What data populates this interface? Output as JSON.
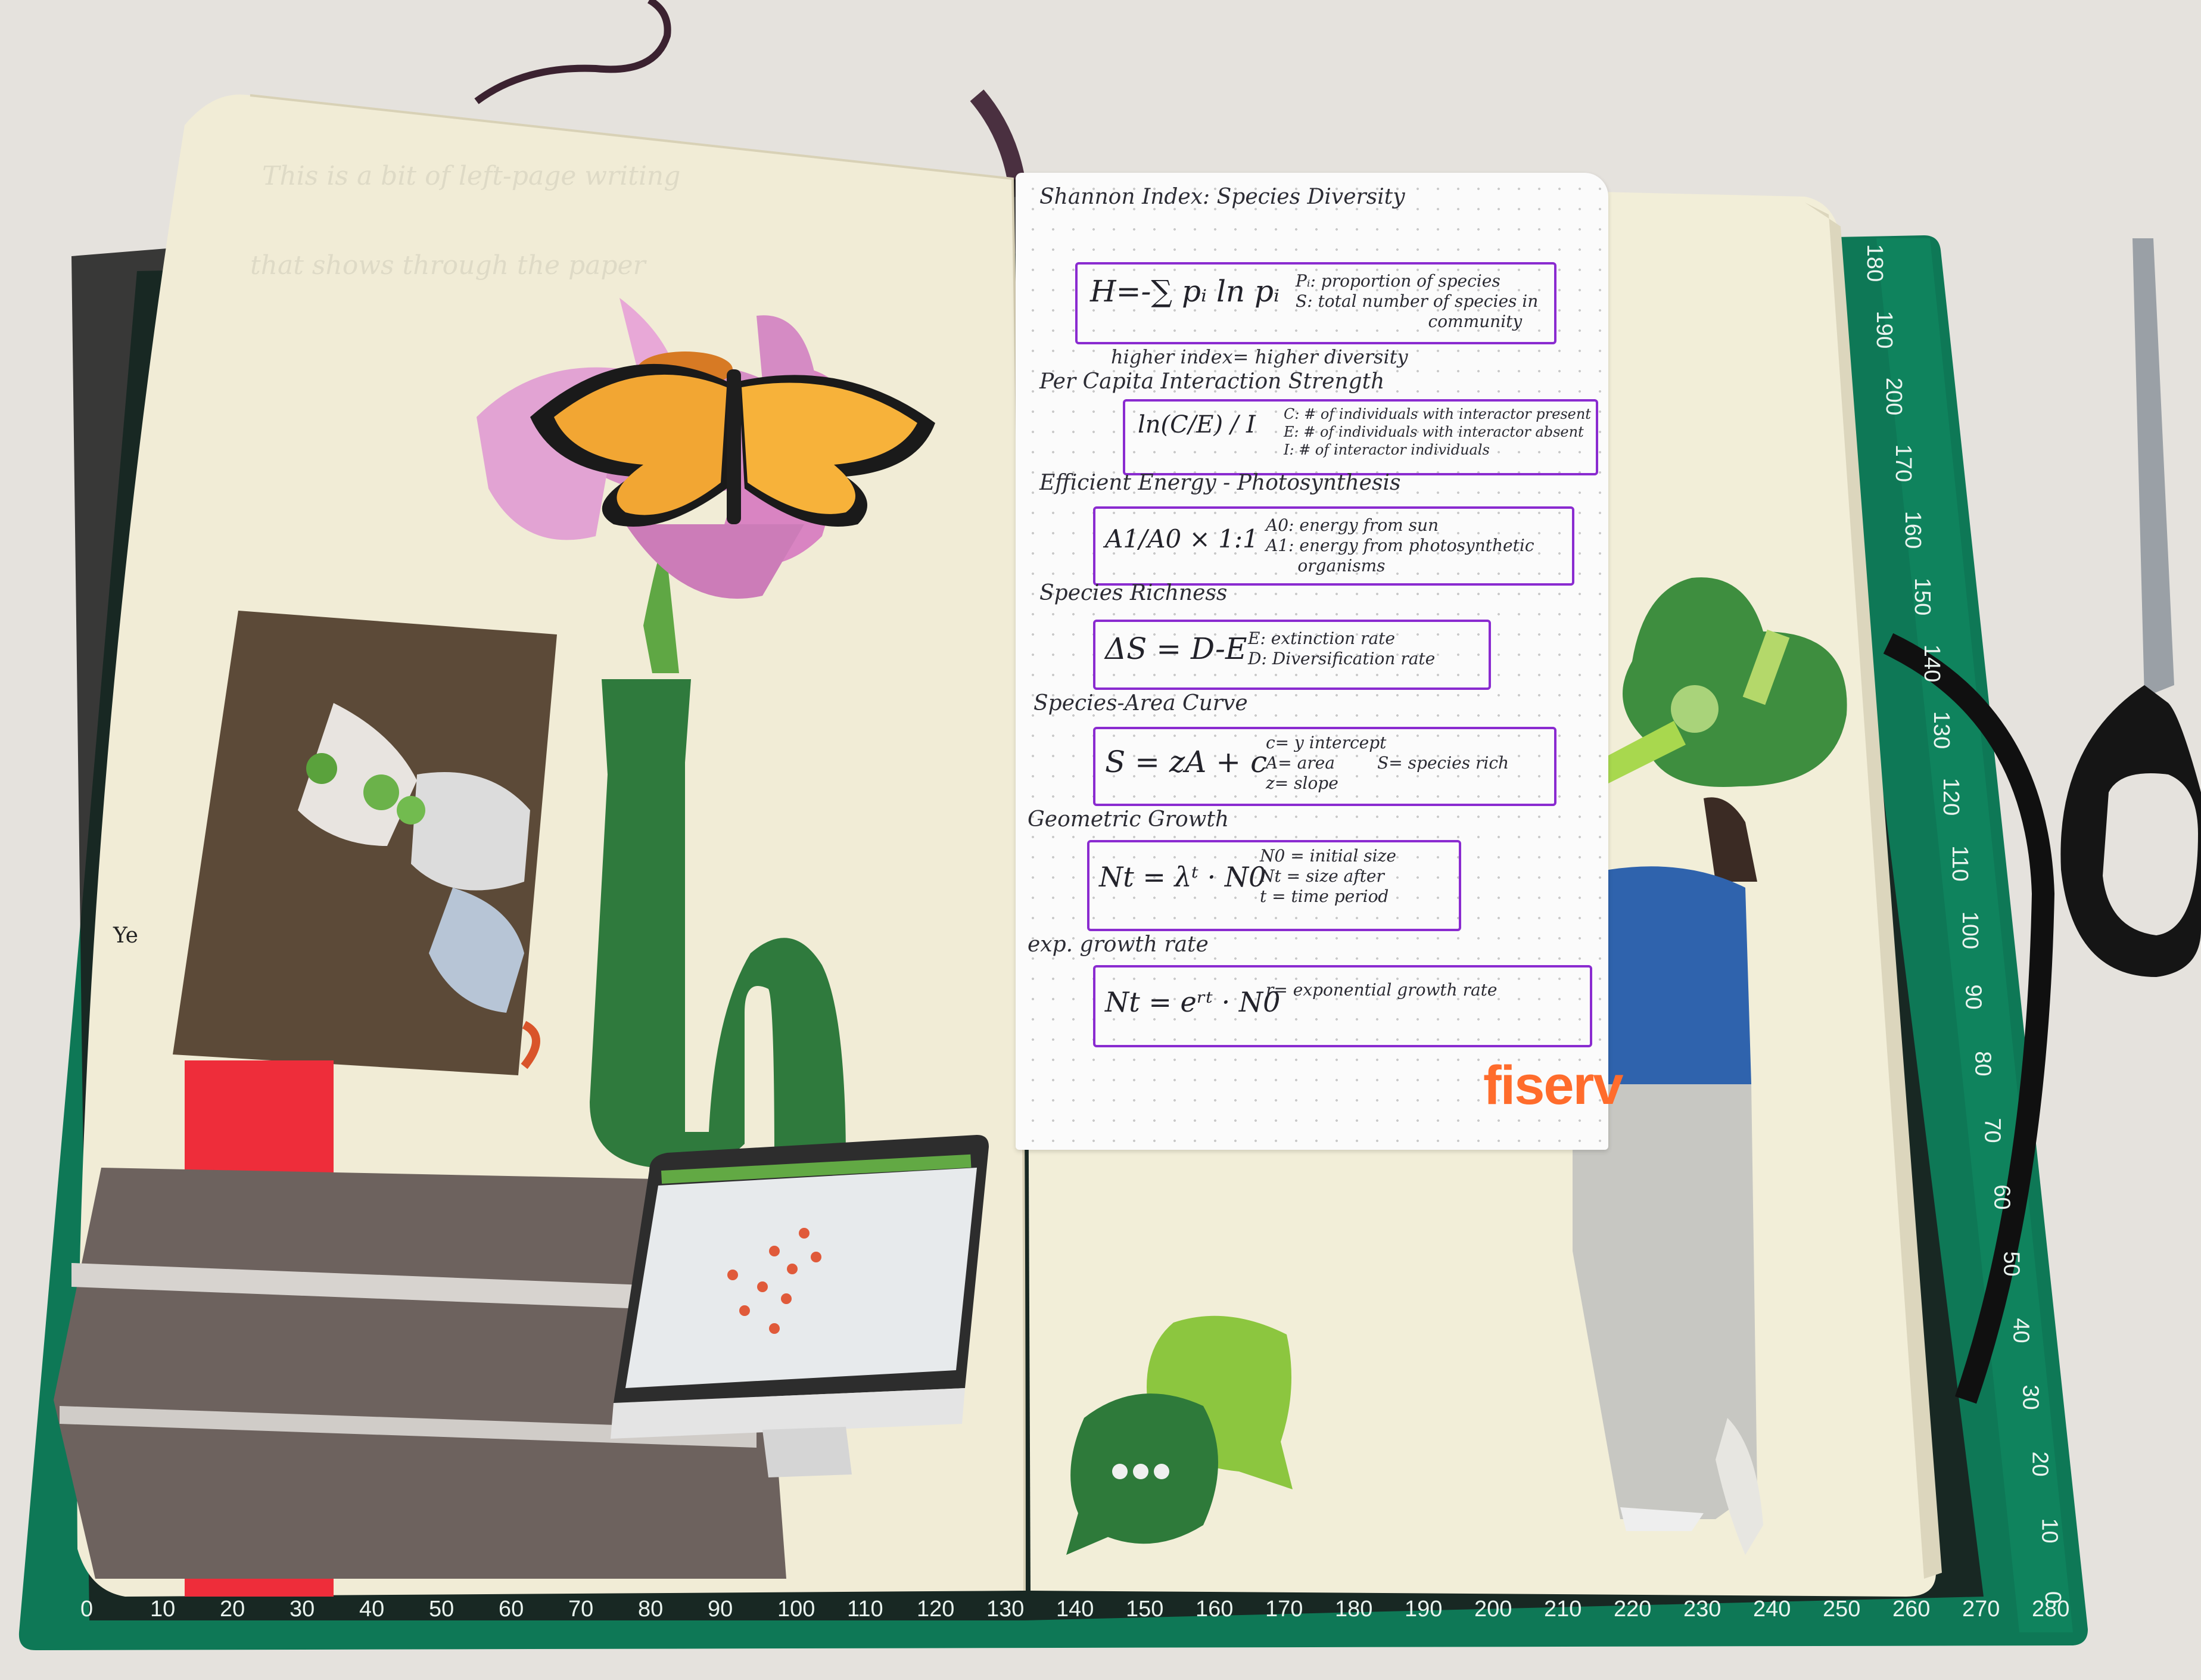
{
  "notes": {
    "title": "Shannon Index: Species Diversity",
    "shannon": {
      "formula": "H=-∑ pᵢ ln pᵢ",
      "defs": "Pᵢ: proportion of species\nS: total number of species in\n                         community"
    },
    "shannon_note": "higher index= higher diversity",
    "percapita_title": "Per Capita Interaction Strength",
    "percapita": {
      "formula": "ln(C/E) / I",
      "defs": "C: # of individuals with interactor present\nE: # of individuals with interactor absent\nI: # of interactor individuals"
    },
    "energy_title": "Efficient Energy - Photosynthesis",
    "energy": {
      "formula": "A1/A0 × 1:1",
      "defs": "A0: energy from sun\nA1: energy from photosynthetic\n      organisms"
    },
    "richness_title": "Species Richness",
    "richness": {
      "formula": "ΔS = D-E",
      "defs": "E: extinction rate\nD: Diversification rate"
    },
    "area_title": "Species-Area Curve",
    "area": {
      "formula": "S = zA + c",
      "defs": "c= y intercept\nA= area        S= species rich\nz= slope"
    },
    "geo_title": "Geometric Growth",
    "geo": {
      "formula": "Nt = λᵗ · N0",
      "defs": "N0 = initial size\nNt = size after\nt = time period"
    },
    "exp_title": "exp. growth rate",
    "exp": {
      "formula": "Nt = eʳᵗ · N0",
      "defs": "r= exponential growth rate"
    }
  },
  "brand_text": "fiserv",
  "left_margin_text": "Ye",
  "ruler": {
    "bottom": [
      "0",
      "10",
      "20",
      "30",
      "40",
      "50",
      "60",
      "70",
      "80",
      "90",
      "100",
      "110",
      "120",
      "130",
      "140",
      "150",
      "160",
      "170",
      "180",
      "190",
      "200",
      "210",
      "220",
      "230",
      "240",
      "250",
      "260",
      "270",
      "280"
    ],
    "right": [
      "180",
      "190",
      "200",
      "170",
      "160",
      "150",
      "140",
      "130",
      "120",
      "110",
      "100",
      "90",
      "80",
      "70",
      "60",
      "50",
      "40",
      "30",
      "20",
      "10",
      "0"
    ]
  },
  "colors": {
    "mat": "#0f7a57",
    "page": "#f3eed6",
    "accent_purple": "#8a2bd0",
    "brand_orange": "#ff6c2c"
  }
}
